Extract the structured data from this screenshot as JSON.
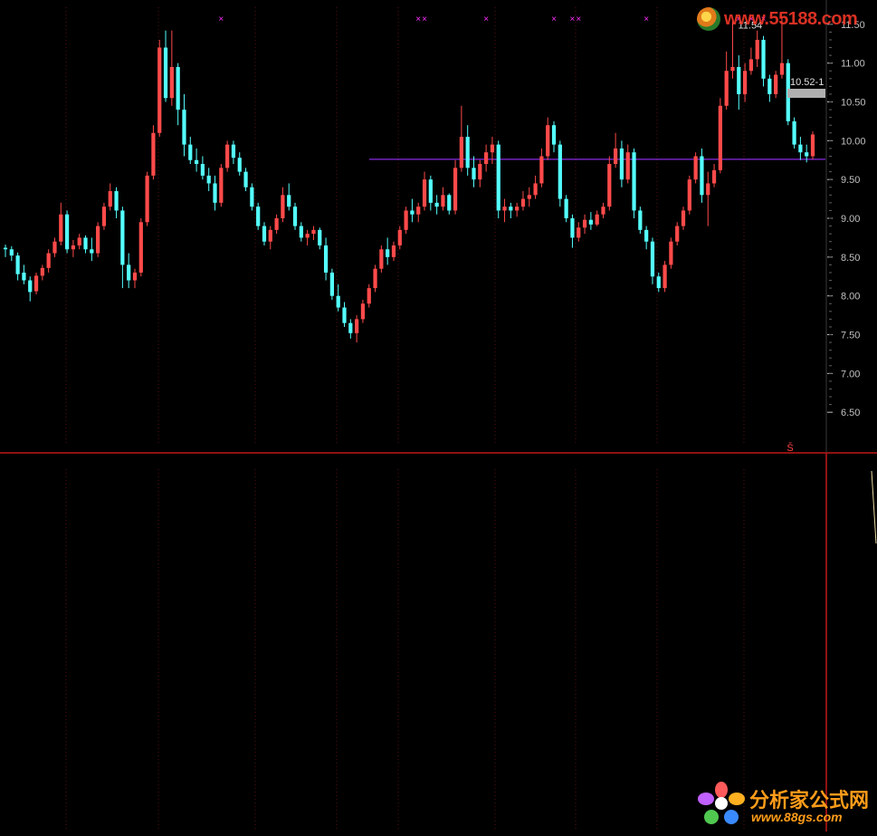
{
  "colors": {
    "background": "#000000",
    "up_candle": "#ff4a4a",
    "down_candle": "#54ffff",
    "separator": "#c01818",
    "axis_text": "#c0c0c0",
    "hline": "#8a2be2",
    "signal_marker": "#ff30ff",
    "vgrid": "#5a1010"
  },
  "price_axis": {
    "labels": [
      "11.50",
      "11.00",
      "10.50",
      "10.00",
      "9.50",
      "9.00",
      "8.50",
      "8.00",
      "7.50",
      "7.00",
      "6.50"
    ],
    "values": [
      11.5,
      11.0,
      10.5,
      10.0,
      9.5,
      9.0,
      8.5,
      8.0,
      7.5,
      7.0,
      6.5
    ]
  },
  "annotations": {
    "high_label": "11.54",
    "right_label": "10.52-1",
    "sub_panel_marker": "Š"
  },
  "hline_price": 9.76,
  "signal_marker_glyph": "×",
  "watermark_top": {
    "text": "www.55188.com"
  },
  "watermark_bottom": {
    "title": "分析家公式网",
    "url": "www.88gs.com"
  },
  "chart_data": {
    "type": "candlestick",
    "ylim": [
      6.0,
      11.72
    ],
    "ohlc": [
      [
        8.62,
        8.66,
        8.5,
        8.6
      ],
      [
        8.6,
        8.64,
        8.45,
        8.52
      ],
      [
        8.52,
        8.56,
        8.2,
        8.28
      ],
      [
        8.3,
        8.4,
        8.15,
        8.2
      ],
      [
        8.2,
        8.25,
        7.93,
        8.05
      ],
      [
        8.06,
        8.3,
        8.02,
        8.26
      ],
      [
        8.26,
        8.4,
        8.2,
        8.36
      ],
      [
        8.36,
        8.6,
        8.3,
        8.55
      ],
      [
        8.55,
        8.75,
        8.5,
        8.7
      ],
      [
        8.7,
        9.2,
        8.65,
        9.05
      ],
      [
        9.05,
        9.1,
        8.55,
        8.6
      ],
      [
        8.6,
        8.72,
        8.5,
        8.65
      ],
      [
        8.65,
        8.8,
        8.6,
        8.75
      ],
      [
        8.75,
        8.78,
        8.55,
        8.6
      ],
      [
        8.6,
        8.75,
        8.45,
        8.55
      ],
      [
        8.55,
        8.95,
        8.5,
        8.9
      ],
      [
        8.9,
        9.2,
        8.85,
        9.15
      ],
      [
        9.15,
        9.45,
        9.1,
        9.35
      ],
      [
        9.35,
        9.4,
        9.0,
        9.1
      ],
      [
        9.1,
        9.15,
        8.1,
        8.4
      ],
      [
        8.4,
        8.55,
        8.1,
        8.2
      ],
      [
        8.2,
        8.35,
        8.1,
        8.3
      ],
      [
        8.3,
        9.0,
        8.25,
        8.95
      ],
      [
        8.95,
        9.6,
        8.9,
        9.55
      ],
      [
        9.55,
        10.2,
        9.5,
        10.1
      ],
      [
        10.1,
        11.3,
        10.05,
        11.2
      ],
      [
        11.2,
        11.42,
        10.5,
        10.55
      ],
      [
        10.55,
        11.42,
        10.45,
        10.95
      ],
      [
        10.95,
        11.0,
        10.2,
        10.4
      ],
      [
        10.4,
        10.6,
        9.8,
        9.95
      ],
      [
        9.95,
        10.05,
        9.7,
        9.75
      ],
      [
        9.75,
        9.9,
        9.6,
        9.7
      ],
      [
        9.7,
        9.8,
        9.5,
        9.55
      ],
      [
        9.55,
        9.65,
        9.35,
        9.45
      ],
      [
        9.45,
        9.55,
        9.1,
        9.2
      ],
      [
        9.2,
        9.7,
        9.15,
        9.65
      ],
      [
        9.65,
        10.0,
        9.6,
        9.95
      ],
      [
        9.95,
        10.0,
        9.7,
        9.78
      ],
      [
        9.78,
        9.85,
        9.55,
        9.6
      ],
      [
        9.6,
        9.65,
        9.35,
        9.4
      ],
      [
        9.4,
        9.45,
        9.1,
        9.15
      ],
      [
        9.15,
        9.2,
        8.85,
        8.9
      ],
      [
        8.9,
        8.95,
        8.65,
        8.7
      ],
      [
        8.7,
        8.9,
        8.6,
        8.85
      ],
      [
        8.85,
        9.05,
        8.8,
        9.0
      ],
      [
        9.0,
        9.4,
        8.95,
        9.3
      ],
      [
        9.3,
        9.45,
        9.1,
        9.15
      ],
      [
        9.15,
        9.2,
        8.85,
        8.9
      ],
      [
        8.9,
        8.95,
        8.7,
        8.75
      ],
      [
        8.75,
        8.85,
        8.65,
        8.8
      ],
      [
        8.8,
        8.9,
        8.72,
        8.85
      ],
      [
        8.85,
        8.88,
        8.6,
        8.65
      ],
      [
        8.65,
        8.75,
        8.2,
        8.3
      ],
      [
        8.3,
        8.35,
        7.95,
        8.0
      ],
      [
        8.0,
        8.15,
        7.8,
        7.85
      ],
      [
        7.85,
        7.92,
        7.6,
        7.65
      ],
      [
        7.65,
        7.7,
        7.45,
        7.52
      ],
      [
        7.52,
        7.75,
        7.4,
        7.7
      ],
      [
        7.7,
        7.95,
        7.65,
        7.9
      ],
      [
        7.9,
        8.15,
        7.85,
        8.1
      ],
      [
        8.1,
        8.4,
        8.05,
        8.35
      ],
      [
        8.35,
        8.65,
        8.3,
        8.6
      ],
      [
        8.6,
        8.75,
        8.4,
        8.5
      ],
      [
        8.5,
        8.7,
        8.45,
        8.65
      ],
      [
        8.65,
        8.9,
        8.6,
        8.85
      ],
      [
        8.85,
        9.15,
        8.8,
        9.1
      ],
      [
        9.1,
        9.25,
        8.95,
        9.05
      ],
      [
        9.05,
        9.2,
        8.95,
        9.15
      ],
      [
        9.15,
        9.6,
        9.1,
        9.5
      ],
      [
        9.5,
        9.55,
        9.1,
        9.2
      ],
      [
        9.2,
        9.3,
        9.05,
        9.15
      ],
      [
        9.15,
        9.4,
        9.1,
        9.3
      ],
      [
        9.3,
        9.32,
        9.05,
        9.1
      ],
      [
        9.1,
        9.75,
        9.05,
        9.65
      ],
      [
        9.65,
        10.45,
        9.6,
        10.05
      ],
      [
        10.05,
        10.2,
        9.55,
        9.65
      ],
      [
        9.65,
        9.8,
        9.4,
        9.5
      ],
      [
        9.5,
        9.75,
        9.4,
        9.7
      ],
      [
        9.7,
        9.95,
        9.6,
        9.85
      ],
      [
        9.85,
        10.05,
        9.7,
        9.95
      ],
      [
        9.95,
        10.0,
        9.0,
        9.1
      ],
      [
        9.1,
        9.25,
        8.95,
        9.15
      ],
      [
        9.15,
        9.2,
        9.0,
        9.1
      ],
      [
        9.1,
        9.2,
        9.02,
        9.15
      ],
      [
        9.15,
        9.35,
        9.1,
        9.25
      ],
      [
        9.25,
        9.4,
        9.15,
        9.3
      ],
      [
        9.3,
        9.55,
        9.25,
        9.45
      ],
      [
        9.45,
        9.9,
        9.4,
        9.8
      ],
      [
        9.8,
        10.3,
        9.75,
        10.2
      ],
      [
        10.2,
        10.25,
        9.85,
        9.95
      ],
      [
        9.95,
        10.0,
        9.15,
        9.25
      ],
      [
        9.25,
        9.3,
        8.95,
        9.0
      ],
      [
        9.0,
        9.05,
        8.62,
        8.75
      ],
      [
        8.75,
        8.95,
        8.7,
        8.88
      ],
      [
        8.88,
        9.05,
        8.8,
        8.98
      ],
      [
        8.98,
        9.08,
        8.85,
        8.92
      ],
      [
        8.92,
        9.1,
        8.9,
        9.05
      ],
      [
        9.05,
        9.2,
        9.0,
        9.15
      ],
      [
        9.15,
        9.8,
        9.1,
        9.7
      ],
      [
        9.7,
        10.1,
        9.65,
        9.9
      ],
      [
        9.9,
        10.0,
        9.4,
        9.5
      ],
      [
        9.5,
        9.95,
        9.45,
        9.85
      ],
      [
        9.85,
        9.9,
        9.0,
        9.1
      ],
      [
        9.1,
        9.15,
        8.8,
        8.85
      ],
      [
        8.85,
        8.9,
        8.6,
        8.7
      ],
      [
        8.7,
        8.75,
        8.15,
        8.25
      ],
      [
        8.25,
        8.3,
        8.05,
        8.1
      ],
      [
        8.1,
        8.45,
        8.05,
        8.4
      ],
      [
        8.4,
        8.75,
        8.35,
        8.7
      ],
      [
        8.7,
        8.95,
        8.65,
        8.9
      ],
      [
        8.9,
        9.15,
        8.85,
        9.1
      ],
      [
        9.1,
        9.55,
        9.05,
        9.5
      ],
      [
        9.5,
        9.85,
        9.45,
        9.8
      ],
      [
        9.8,
        9.9,
        9.2,
        9.3
      ],
      [
        9.3,
        9.6,
        8.9,
        9.45
      ],
      [
        9.45,
        9.7,
        9.4,
        9.62
      ],
      [
        9.62,
        10.55,
        9.58,
        10.45
      ],
      [
        10.45,
        11.15,
        10.4,
        10.9
      ],
      [
        10.9,
        11.54,
        10.8,
        10.95
      ],
      [
        10.95,
        11.1,
        10.4,
        10.6
      ],
      [
        10.6,
        11.0,
        10.5,
        10.9
      ],
      [
        10.9,
        11.2,
        10.85,
        11.05
      ],
      [
        11.05,
        11.42,
        10.95,
        11.3
      ],
      [
        11.3,
        11.35,
        10.7,
        10.8
      ],
      [
        10.8,
        10.85,
        10.5,
        10.6
      ],
      [
        10.6,
        10.9,
        10.55,
        10.85
      ],
      [
        10.85,
        11.6,
        10.8,
        11.0
      ],
      [
        11.0,
        11.05,
        10.2,
        10.25
      ],
      [
        10.25,
        10.3,
        9.9,
        9.95
      ],
      [
        9.95,
        10.05,
        9.75,
        9.85
      ],
      [
        9.85,
        9.95,
        9.72,
        9.8
      ],
      [
        9.8,
        10.12,
        9.76,
        10.08
      ]
    ],
    "signal_indices": [
      35,
      67,
      68,
      78,
      89,
      92,
      93,
      104,
      114,
      115,
      119,
      121,
      123
    ]
  }
}
